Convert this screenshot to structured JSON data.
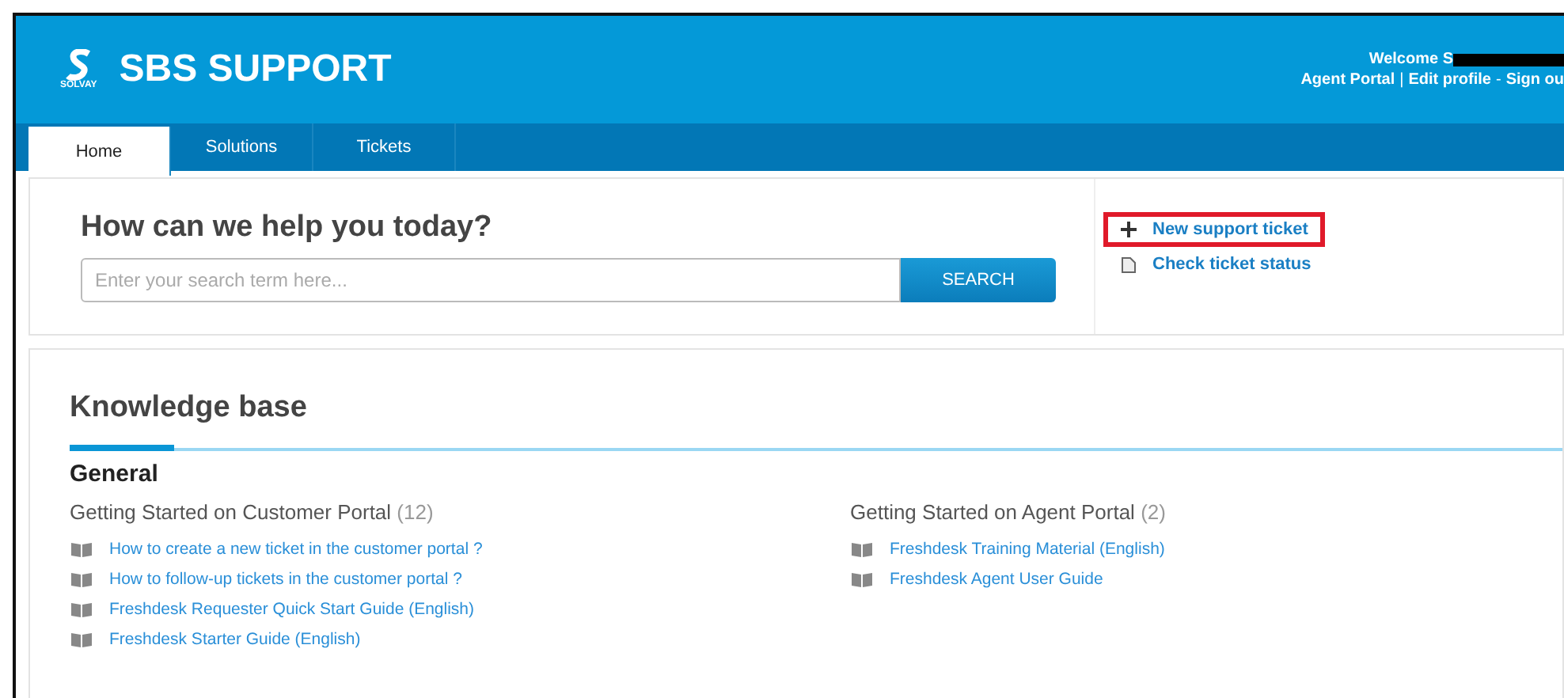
{
  "header": {
    "logo_caption": "SOLVAY",
    "title": "SBS SUPPORT",
    "welcome": "Welcome S",
    "user_links": [
      {
        "kind": "link",
        "label": "Agent Portal"
      },
      {
        "kind": "sep",
        "label": "|"
      },
      {
        "kind": "link",
        "label": "Edit profile"
      },
      {
        "kind": "sep",
        "label": "-"
      },
      {
        "kind": "link",
        "label": "Sign ou"
      }
    ]
  },
  "tabs": [
    {
      "label": "Home",
      "selected": true
    },
    {
      "label": "Solutions",
      "selected": false
    },
    {
      "label": "Tickets",
      "selected": false
    }
  ],
  "help": {
    "title": "How can we help you today?",
    "search": {
      "placeholder": "Enter your search term here...",
      "button": "SEARCH"
    },
    "actions": [
      {
        "kind": "new",
        "label": "New support ticket",
        "highlighted": true
      },
      {
        "kind": "status",
        "label": "Check ticket status",
        "highlighted": false
      }
    ]
  },
  "knowledge_base": {
    "title": "Knowledge base",
    "section": "General",
    "folders": [
      {
        "title": "Getting Started on Customer Portal",
        "count": "(12)",
        "articles": [
          "How to create a new ticket in the customer portal ?",
          "How to follow-up tickets in the customer portal ?",
          "Freshdesk Requester Quick Start Guide (English)",
          "Freshdesk Starter Guide (English)"
        ]
      },
      {
        "title": "Getting Started on Agent Portal",
        "count": "(2)",
        "articles": [
          "Freshdesk Training Material (English)",
          "Freshdesk Agent User Guide"
        ]
      }
    ]
  }
}
